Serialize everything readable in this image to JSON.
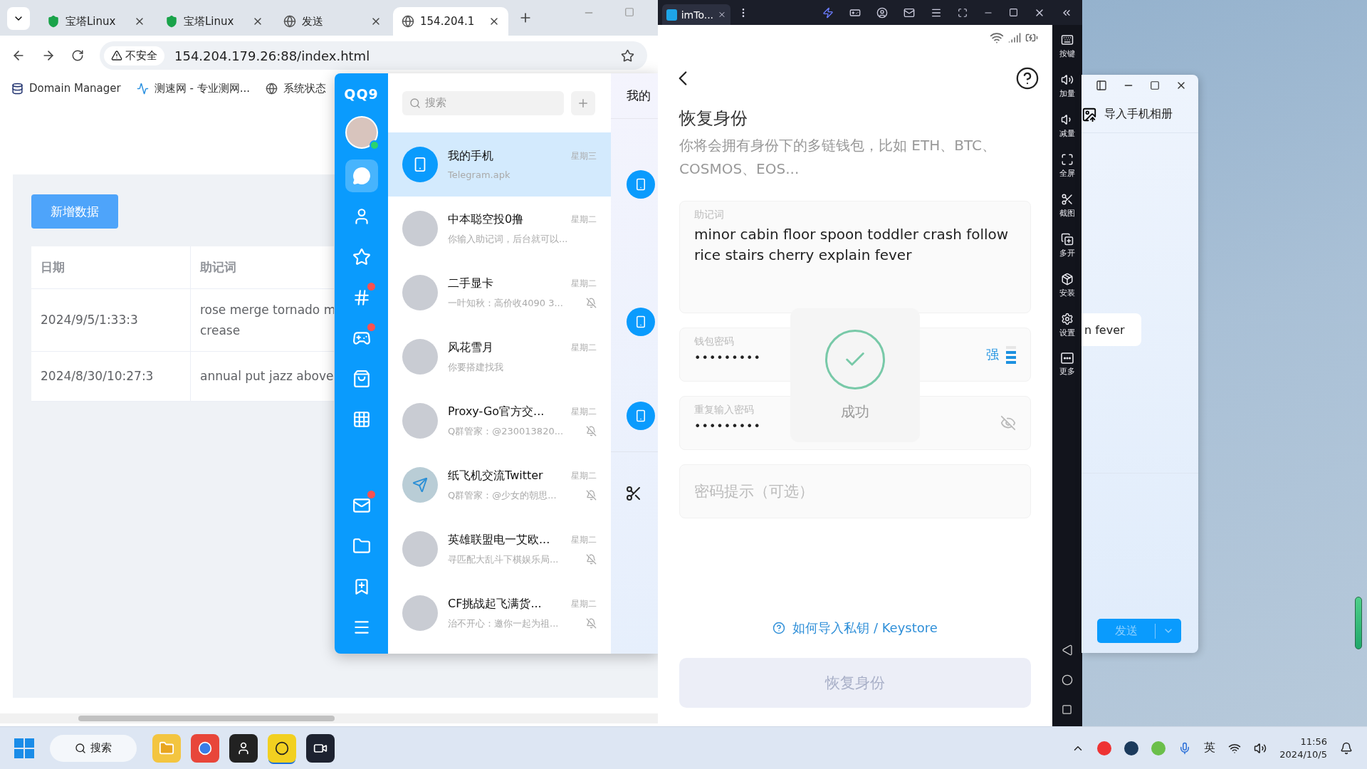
{
  "browser": {
    "tabs": [
      {
        "kind": "shield",
        "label": "宝塔Linux",
        "selected": false
      },
      {
        "kind": "shield",
        "label": "宝塔Linux",
        "selected": false
      },
      {
        "kind": "globe",
        "label": "发送",
        "selected": false
      },
      {
        "kind": "globe",
        "label": "154.204.1",
        "selected": true
      }
    ],
    "security_label": "不安全",
    "url": "154.204.179.26:88/index.html",
    "bookmarks": [
      {
        "kind": "database",
        "label": "Domain Manager"
      },
      {
        "kind": "speed",
        "label": "测速网 - 专业测网..."
      },
      {
        "kind": "globe",
        "label": "系统状态"
      }
    ],
    "add_button": "新增数据",
    "table": {
      "columns": [
        "日期",
        "助记词"
      ],
      "rows": [
        {
          "date": "2024/9/5/1:33:3",
          "mnemonic": [
            "rose merge tornado m",
            "crease"
          ]
        },
        {
          "date": "2024/8/30/10:27:3",
          "mnemonic": [
            "annual put jazz above"
          ]
        }
      ]
    }
  },
  "qq": {
    "logo": "QQ9",
    "online": true,
    "rail_top": [
      {
        "kind": "chat",
        "selected": true,
        "badge": false
      },
      {
        "kind": "contacts",
        "selected": false,
        "badge": false
      },
      {
        "kind": "star",
        "selected": false,
        "badge": false
      },
      {
        "kind": "hash",
        "selected": false,
        "badge": true
      },
      {
        "kind": "game",
        "selected": false,
        "badge": true
      },
      {
        "kind": "shop",
        "selected": false,
        "badge": false
      },
      {
        "kind": "apps",
        "selected": false,
        "badge": false
      }
    ],
    "rail_bottom": [
      {
        "kind": "mail",
        "badge": true
      },
      {
        "kind": "folder",
        "badge": false
      },
      {
        "kind": "bookmark",
        "badge": false
      },
      {
        "kind": "menu",
        "badge": false
      }
    ],
    "search_placeholder": "搜索",
    "chats": [
      {
        "kind": "device",
        "name": "我的手机",
        "time": "星期三",
        "preview": "Telegram.apk",
        "muted": false,
        "selected": true
      },
      {
        "kind": "photo",
        "name": "中本聪空投0撸",
        "time": "星期二",
        "preview": "你输入助记词，后台就可以...",
        "muted": false,
        "selected": false
      },
      {
        "kind": "photo",
        "name": "二手显卡",
        "time": "星期二",
        "preview": "一叶知秋：高价收4090 3...",
        "muted": true,
        "selected": false
      },
      {
        "kind": "photo",
        "name": "风花雪月",
        "time": "星期二",
        "preview": "你要搭建找我",
        "muted": false,
        "selected": false
      },
      {
        "kind": "photo",
        "name": "Proxy-Go官方交...",
        "time": "星期二",
        "preview": "Q群管家：@230013820...",
        "muted": true,
        "selected": false
      },
      {
        "kind": "plane",
        "name": "纸飞机交流Twitter",
        "time": "星期二",
        "preview": "Q群管家：@少女的朝思...",
        "muted": true,
        "selected": false
      },
      {
        "kind": "photo",
        "name": "英雄联盟电一艾欧...",
        "time": "星期二",
        "preview": "寻匹配大乱斗下棋娱乐局...",
        "muted": true,
        "selected": false
      },
      {
        "kind": "photo",
        "name": "CF挑战起飞满货...",
        "time": "星期二",
        "preview": "治不开心：邀你一起为祖...",
        "muted": true,
        "selected": false
      }
    ],
    "chat_title": "我的"
  },
  "emulator": {
    "tab_label": "imTo...",
    "toolbar": [
      {
        "kind": "keys",
        "label": "按键"
      },
      {
        "kind": "volup",
        "label": "加量"
      },
      {
        "kind": "voldown",
        "label": "减量"
      },
      {
        "kind": "fullscreen",
        "label": "全屏"
      },
      {
        "kind": "screenshot",
        "label": "截图"
      },
      {
        "kind": "multi",
        "label": "多开"
      },
      {
        "kind": "install",
        "label": "安装"
      },
      {
        "kind": "settings",
        "label": "设置"
      },
      {
        "kind": "more",
        "label": "更多"
      }
    ],
    "phone": {
      "title": "恢复身份",
      "subtitle": "你将会拥有身份下的多链钱包，比如 ETH、BTC、COSMOS、EOS...",
      "mnemonic_label": "助记词",
      "mnemonic": "minor cabin floor spoon toddler crash follow rice stairs cherry explain fever",
      "password_label": "钱包密码",
      "password": "•••••••••",
      "strength_label": "强",
      "strength": {
        "level": 0.75
      },
      "repeat_label": "重复输入密码",
      "repeat": "•••••••••",
      "hint_placeholder": "密码提示（可选）",
      "toast": "成功",
      "help_link": "如何导入私钥 / Keystore",
      "submit": "恢复身份",
      "submit_disabled": true
    }
  },
  "chat_window": {
    "title": "导入手机相册",
    "bubble": "n fever",
    "send": "发送"
  },
  "taskbar": {
    "search": "搜索",
    "ime": "英",
    "time": "11:56",
    "date": "2024/10/5"
  }
}
